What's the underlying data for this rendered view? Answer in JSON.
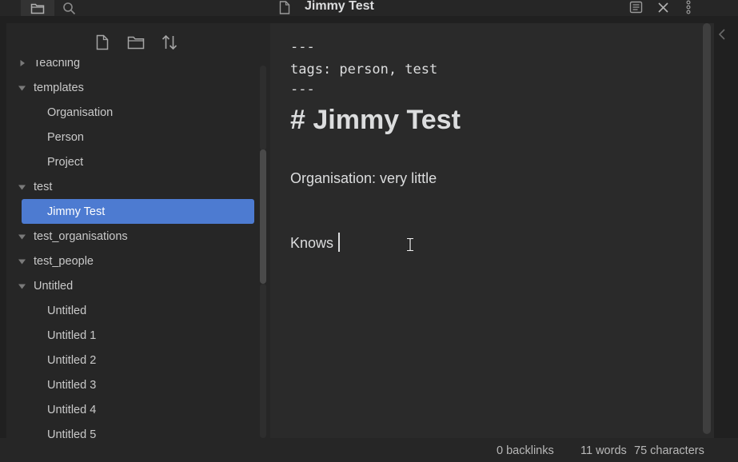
{
  "editor": {
    "title": "Jimmy Test",
    "lines": {
      "fm_open": "---",
      "fm_tags": "tags: person, test",
      "fm_close": "---",
      "heading": "# Jimmy Test",
      "organisation": "Organisation: very little",
      "knows": "Knows"
    }
  },
  "tree": {
    "items": [
      {
        "label": "Teaching"
      },
      {
        "label": "templates"
      },
      {
        "label": "Organisation"
      },
      {
        "label": "Person"
      },
      {
        "label": "Project"
      },
      {
        "label": "test"
      },
      {
        "label": "Jimmy Test"
      },
      {
        "label": "test_organisations"
      },
      {
        "label": "test_people"
      },
      {
        "label": "Untitled"
      },
      {
        "label": "Untitled"
      },
      {
        "label": "Untitled 1"
      },
      {
        "label": "Untitled 2"
      },
      {
        "label": "Untitled 3"
      },
      {
        "label": "Untitled 4"
      },
      {
        "label": "Untitled 5"
      }
    ]
  },
  "status": {
    "backlinks": "0 backlinks",
    "words": "11 words",
    "characters": "75 characters"
  },
  "colors": {
    "accent": "#4d7bd1",
    "background": "#202020",
    "panel": "#262626",
    "editor": "#2a2a2a"
  },
  "icons": {
    "folder": "folder-icon",
    "search": "search-icon",
    "new_note": "new-note-icon",
    "new_folder": "new-folder-icon",
    "sort": "sort-icon",
    "file": "file-icon",
    "reading_view": "reading-view-icon",
    "close": "close-icon",
    "more": "more-options-icon",
    "collapse_right": "chevron-left-icon"
  }
}
